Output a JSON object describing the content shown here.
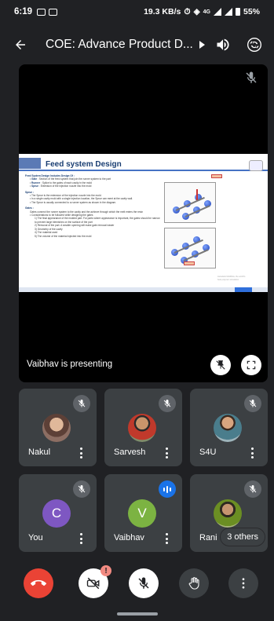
{
  "status_bar": {
    "time": "6:19",
    "network_speed": "19.3 KB/s",
    "network_type": "4G",
    "battery": "55%"
  },
  "header": {
    "title": "COE: Advance Product D..."
  },
  "presentation": {
    "presenter_label": "Vaibhav is presenting",
    "slide": {
      "title": "Feed system Design",
      "heading": "Feed System Design Includes Design Of :",
      "items": [
        {
          "term": "Gate",
          "text": ": Section of the feed system that join the runner system to the part"
        },
        {
          "term": "Runner",
          "text": ": Splice to the gates of each cavity in the mold"
        },
        {
          "term": "Sprue",
          "text": ": Extension of the injection nozzle into the mold"
        }
      ],
      "sprue_heading": "Sprue :",
      "sprue_items": [
        "The Sprue is the extension of the injection nozzle into the mold.",
        "In a single cavity mold with a single injection location, the Sprue can meet at the cavity wall.",
        "The Sprue is usually connected to a runner system as shown in the diagram."
      ],
      "gates_heading": "Gates :",
      "gates_text": "Gates connect the runner system to the cavity and the achieve through which the melt enters the resin",
      "gates_sub": "Considerations to be followed while designing the gates",
      "gates_list": [
        "The final appearance of the molded part. For parts where appearance is important, the gates should be narrow to prevent large blemishes on the surface of the part",
        "Removal of the part. A smaller opening will make gate removal easier",
        "Geometry of the cavity",
        "The material used",
        "The volume of the material injected into the mold"
      ],
      "fig_tag_top": "Sprue",
      "fig_tag_bottom": "Gate",
      "footer_note": "Autodesk Moldflow, the world's best polymer simulation"
    }
  },
  "participants": [
    {
      "name": "Nakul",
      "muted": true,
      "avatar_type": "photo",
      "avatar_color": "#8d6e63"
    },
    {
      "name": "Sarvesh",
      "muted": true,
      "avatar_type": "photo",
      "avatar_color": "#c0392b"
    },
    {
      "name": "S4U",
      "muted": true,
      "avatar_type": "photo",
      "avatar_color": "#4a7d8c"
    },
    {
      "name": "You",
      "muted": true,
      "avatar_type": "letter",
      "avatar_letter": "C",
      "avatar_color": "#7e57c2"
    },
    {
      "name": "Vaibhav",
      "muted": false,
      "speaking": true,
      "avatar_type": "letter",
      "avatar_letter": "V",
      "avatar_color": "#7cb342"
    },
    {
      "name": "Rani",
      "muted": true,
      "avatar_type": "photo",
      "avatar_color": "#6b8e23"
    }
  ],
  "others_label": "3 others",
  "controls": {
    "camera_badge": "!"
  },
  "colors": {
    "background": "#202124",
    "tile": "#3c4043",
    "end_call": "#ea4335",
    "speaking_indicator": "#1a73e8"
  }
}
